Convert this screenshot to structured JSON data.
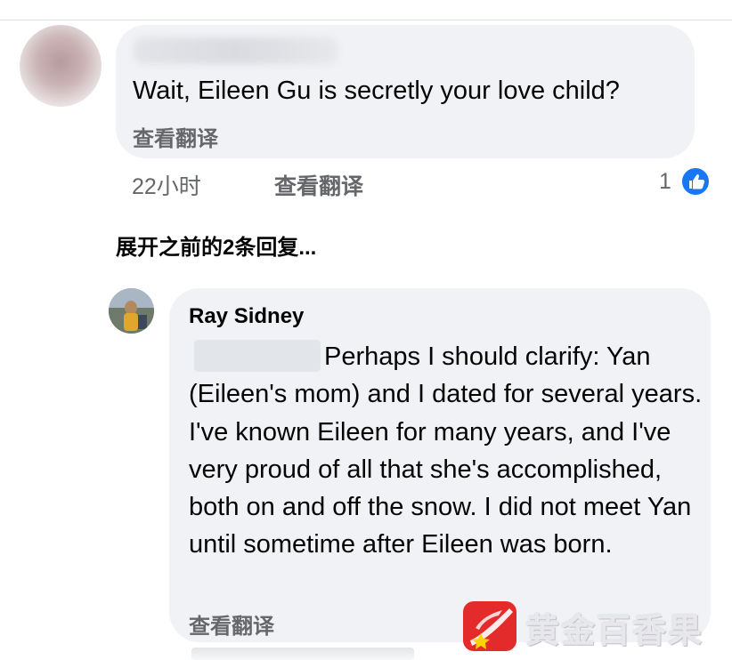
{
  "comment1": {
    "text": "Wait, Eileen Gu is secretly your love child?",
    "see_translation": "查看翻译",
    "time": "22小时",
    "meta_translation": "查看翻译",
    "like_count": "1"
  },
  "expand_replies": "展开之前的2条回复...",
  "comment2": {
    "author": "Ray Sidney",
    "text": "Perhaps I should clarify: Yan (Eileen's mom) and I dated for several years. I've known Eileen for many years, and I've very proud of all that she's accomplished, both on and off the snow. I did not meet Yan until sometime after Eileen was born.",
    "see_translation": "查看翻译"
  },
  "watermark": {
    "text": "黄金百香果",
    "badge_color": "#e32b2b"
  },
  "colors": {
    "bubble": "#f0f2f5",
    "secondary_text": "#65676b",
    "like_blue": "#1877f2"
  },
  "icons": [
    "like-thumb-icon",
    "watermark-logo-icon"
  ]
}
